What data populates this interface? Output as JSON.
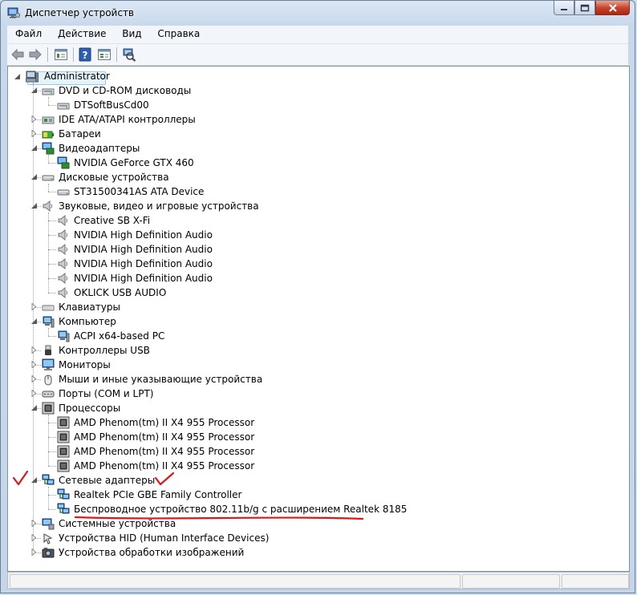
{
  "window": {
    "title": "Диспетчер устройств"
  },
  "menu": {
    "items": [
      "Файл",
      "Действие",
      "Вид",
      "Справка"
    ]
  },
  "toolbar": {
    "buttons": [
      "back-icon",
      "forward-icon",
      "properties-icon",
      "help-icon",
      "show-hidden-icon",
      "scan-hardware-icon"
    ]
  },
  "tree": {
    "root": "Administrator",
    "rows": [
      {
        "level": 1,
        "state": "open",
        "label": "DVD и CD-ROM дисководы",
        "icon": "dvd-icon"
      },
      {
        "level": 2,
        "label": "DTSoftBusCd00",
        "icon": "dvd-icon"
      },
      {
        "level": 1,
        "state": "closed",
        "label": "IDE ATA/ATAPI контроллеры",
        "icon": "ide-controller-icon"
      },
      {
        "level": 1,
        "state": "closed",
        "label": "Батареи",
        "icon": "battery-icon"
      },
      {
        "level": 1,
        "state": "open",
        "label": "Видеоадаптеры",
        "icon": "display-adapter-icon"
      },
      {
        "level": 2,
        "label": "NVIDIA GeForce GTX 460",
        "icon": "display-adapter-icon"
      },
      {
        "level": 1,
        "state": "open",
        "label": "Дисковые устройства",
        "icon": "disk-drive-icon"
      },
      {
        "level": 2,
        "label": "ST31500341AS ATA Device",
        "icon": "disk-drive-icon"
      },
      {
        "level": 1,
        "state": "open",
        "label": "Звуковые, видео и игровые устройства",
        "icon": "speaker-icon"
      },
      {
        "level": 2,
        "label": "Creative SB X-Fi",
        "icon": "speaker-icon"
      },
      {
        "level": 2,
        "label": "NVIDIA High Definition Audio",
        "icon": "speaker-icon"
      },
      {
        "level": 2,
        "label": "NVIDIA High Definition Audio",
        "icon": "speaker-icon"
      },
      {
        "level": 2,
        "label": "NVIDIA High Definition Audio",
        "icon": "speaker-icon"
      },
      {
        "level": 2,
        "label": "NVIDIA High Definition Audio",
        "icon": "speaker-icon"
      },
      {
        "level": 2,
        "label": "OKLICK USB AUDIO",
        "icon": "speaker-icon"
      },
      {
        "level": 1,
        "state": "closed",
        "label": "Клавиатуры",
        "icon": "keyboard-icon"
      },
      {
        "level": 1,
        "state": "open",
        "label": "Компьютер",
        "icon": "computer-icon"
      },
      {
        "level": 2,
        "label": "ACPI x64-based PC",
        "icon": "computer-icon"
      },
      {
        "level": 1,
        "state": "closed",
        "label": "Контроллеры USB",
        "icon": "usb-icon"
      },
      {
        "level": 1,
        "state": "closed",
        "label": "Мониторы",
        "icon": "monitor-icon"
      },
      {
        "level": 1,
        "state": "closed",
        "label": "Мыши и иные указывающие устройства",
        "icon": "mouse-icon"
      },
      {
        "level": 1,
        "state": "closed",
        "label": "Порты (COM и LPT)",
        "icon": "port-icon"
      },
      {
        "level": 1,
        "state": "open",
        "label": "Процессоры",
        "icon": "processor-icon"
      },
      {
        "level": 2,
        "label": "AMD Phenom(tm) II X4 955 Processor",
        "icon": "processor-icon"
      },
      {
        "level": 2,
        "label": "AMD Phenom(tm) II X4 955 Processor",
        "icon": "processor-icon"
      },
      {
        "level": 2,
        "label": "AMD Phenom(tm) II X4 955 Processor",
        "icon": "processor-icon"
      },
      {
        "level": 2,
        "label": "AMD Phenom(tm) II X4 955 Processor",
        "icon": "processor-icon"
      },
      {
        "level": 1,
        "state": "open",
        "label": "Сетевые адаптеры",
        "icon": "network-adapter-icon"
      },
      {
        "level": 2,
        "label": "Realtek PCIe GBE Family Controller",
        "icon": "network-adapter-icon"
      },
      {
        "level": 2,
        "label": "Беспроводное устройство 802.11b/g с расширением Realtek 8185",
        "icon": "network-adapter-icon"
      },
      {
        "level": 1,
        "state": "closed",
        "label": "Системные устройства",
        "icon": "system-device-icon"
      },
      {
        "level": 1,
        "state": "closed",
        "label": "Устройства HID (Human Interface Devices)",
        "icon": "hid-icon"
      },
      {
        "level": 1,
        "state": "closed",
        "label": "Устройства обработки изображений",
        "icon": "camera-icon"
      }
    ]
  },
  "colors": {
    "annotation": "#e0161b",
    "selection": "#e5f3fb"
  }
}
